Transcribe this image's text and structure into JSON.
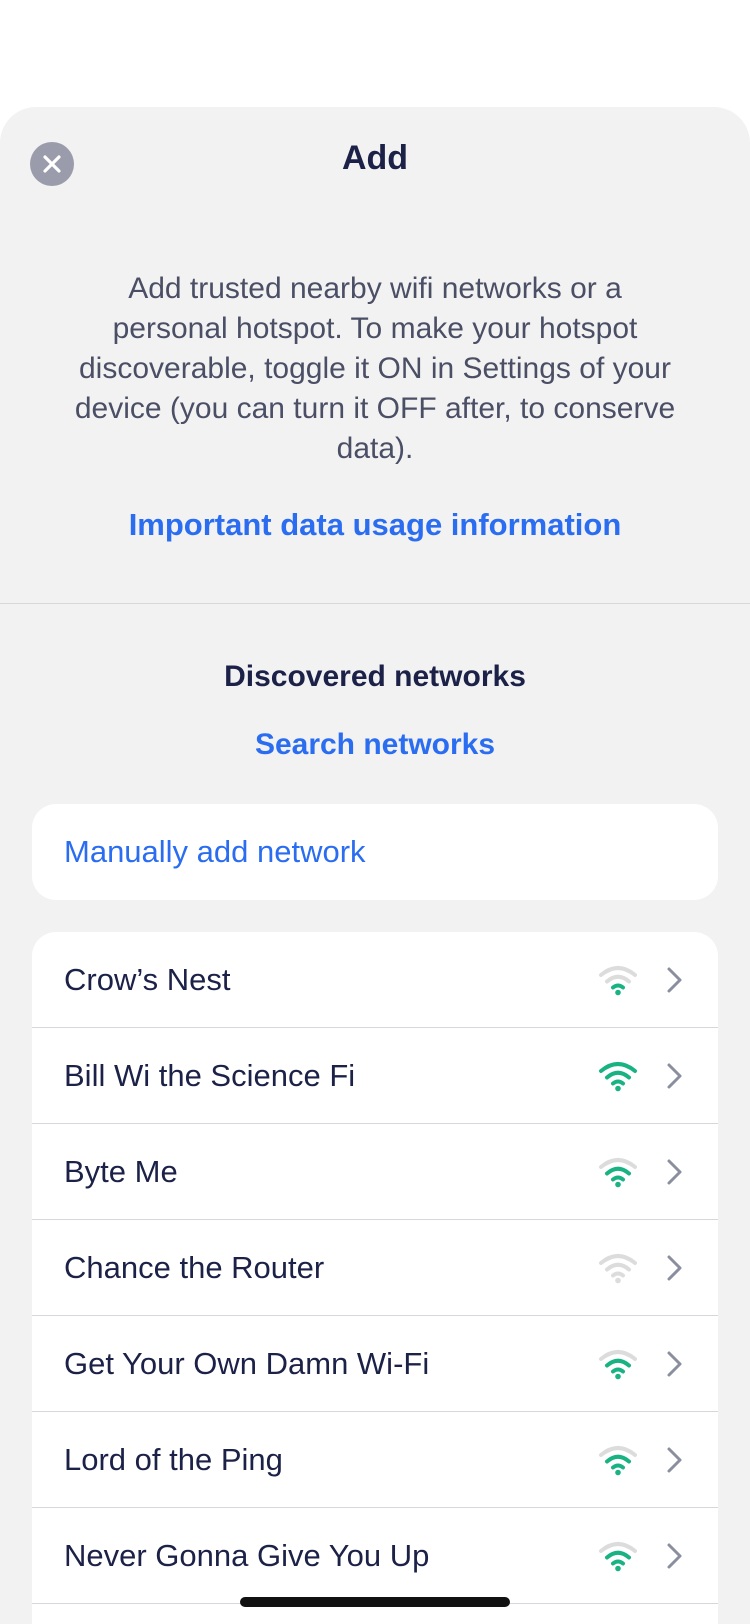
{
  "sheet": {
    "title": "Add",
    "close_icon": "close-icon",
    "description": "Add trusted nearby wifi networks or a personal hotspot. To make your hotspot discoverable, toggle it ON in Settings of your device (you can turn it OFF after, to conserve data).",
    "data_usage_link": "Important data usage information"
  },
  "discovered": {
    "title": "Discovered networks",
    "search_link": "Search networks",
    "manual_add_label": "Manually add network"
  },
  "colors": {
    "accent": "#2a6df0",
    "signal_on": "#19b383",
    "signal_off": "#dcdcdc"
  },
  "networks": [
    {
      "name": "Crow’s Nest",
      "signal_bars": 1
    },
    {
      "name": "Bill Wi the Science Fi",
      "signal_bars": 3
    },
    {
      "name": "Byte Me",
      "signal_bars": 2
    },
    {
      "name": "Chance the Router",
      "signal_bars": 0
    },
    {
      "name": "Get Your Own Damn Wi-Fi",
      "signal_bars": 2
    },
    {
      "name": "Lord of the Ping",
      "signal_bars": 2
    },
    {
      "name": "Never Gonna Give You Up",
      "signal_bars": 2
    }
  ]
}
